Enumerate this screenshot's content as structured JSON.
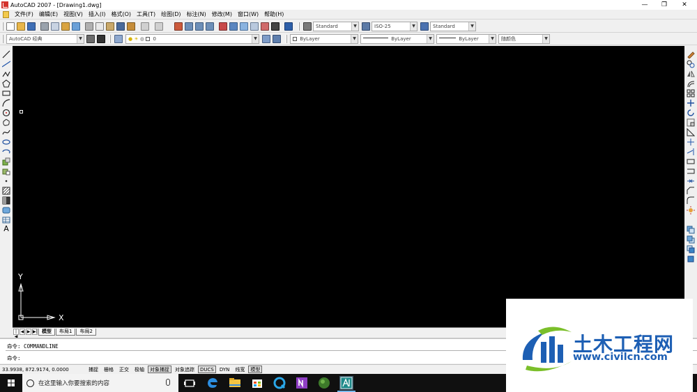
{
  "window": {
    "title": "AutoCAD 2007 - [Drawing1.dwg]",
    "controls": [
      "—",
      "❐",
      "✕"
    ]
  },
  "menu": [
    "文件(F)",
    "编辑(E)",
    "视图(V)",
    "插入(I)",
    "格式(O)",
    "工具(T)",
    "绘图(D)",
    "标注(N)",
    "修改(M)",
    "窗口(W)",
    "帮助(H)"
  ],
  "toolbar1": {
    "text_style": "Standard",
    "dim_style": "ISO-25",
    "table_style": "Standard"
  },
  "toolbar2": {
    "workspace": "AutoCAD 经典",
    "layer": "0",
    "color": "ByLayer",
    "linetype": "ByLayer",
    "lineweight": "ByLayer",
    "plot_style": "随颜色"
  },
  "ucs": {
    "x_label": "X",
    "y_label": "Y"
  },
  "layout_tabs": [
    "模型",
    "布局1",
    "布局2"
  ],
  "command": {
    "history": "命令: COMMANDLINE",
    "prompt": "命令:"
  },
  "status": {
    "coords": "33.9938,  872.9174,  0.0000",
    "buttons": [
      {
        "label": "捕捉",
        "on": false
      },
      {
        "label": "栅格",
        "on": false
      },
      {
        "label": "正交",
        "on": false
      },
      {
        "label": "极轴",
        "on": false
      },
      {
        "label": "对象捕捉",
        "on": true
      },
      {
        "label": "对象追踪",
        "on": false
      },
      {
        "label": "DUCS",
        "on": true
      },
      {
        "label": "DYN",
        "on": false
      },
      {
        "label": "线宽",
        "on": false
      },
      {
        "label": "模型",
        "on": true
      }
    ]
  },
  "taskbar": {
    "search_placeholder": "在这里输入你要搜索的内容"
  },
  "watermark": {
    "name": "土木工程网",
    "url": "www.civilcn.com"
  },
  "colors": {
    "canvas": "#000000",
    "chrome": "#f0f0f0",
    "taskbar": "#101010",
    "watermark_blue": "#1d5fb4",
    "watermark_green": "#7bbf2a"
  }
}
